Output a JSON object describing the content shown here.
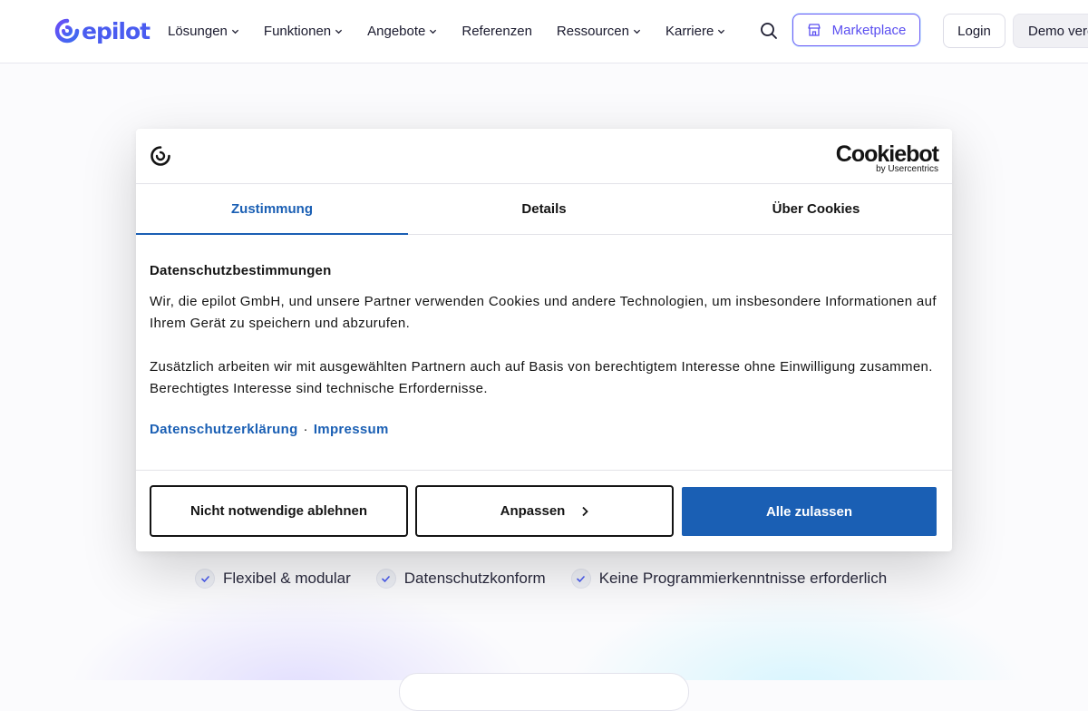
{
  "header": {
    "logo_text": "epilot",
    "nav": [
      {
        "label": "Lösungen",
        "has_dropdown": true
      },
      {
        "label": "Funktionen",
        "has_dropdown": true
      },
      {
        "label": "Angebote",
        "has_dropdown": true
      },
      {
        "label": "Referenzen",
        "has_dropdown": false
      },
      {
        "label": "Ressourcen",
        "has_dropdown": true
      },
      {
        "label": "Karriere",
        "has_dropdown": true
      }
    ],
    "search_icon": "search-icon",
    "marketplace_label": "Marketplace",
    "login_label": "Login",
    "demo_label": "Demo vereinbaren"
  },
  "page": {
    "features": [
      "Flexibel & modular",
      "Datenschutzkonform",
      "Keine Programmierkenntnisse erforderlich"
    ]
  },
  "cookie_dialog": {
    "brand_name": "Cookiebot",
    "brand_by": "by Usercentrics",
    "tabs": [
      "Zustimmung",
      "Details",
      "Über Cookies"
    ],
    "active_tab": "Zustimmung",
    "title": "Datenschutzbestimmungen",
    "paragraph1": "Wir, die epilot GmbH, und unsere Partner verwenden Cookies und andere Technologien, um insbesondere Informationen auf Ihrem Gerät zu speichern und abzurufen.",
    "paragraph2": "Zusätzlich arbeiten wir mit ausgewählten Partnern auch auf Basis von berechtigtem Interesse ohne Einwilligung zusam­men. Berechtigtes Interesse sind technische Erfordernisse.",
    "link_privacy": "Datenschutzerklärung",
    "link_separator": "·",
    "link_imprint": "Impressum",
    "btn_reject": "Nicht notwendige ablehnen",
    "btn_customize": "Anpassen",
    "btn_allow": "Alle zulassen"
  },
  "colors": {
    "brand": "#4a5cf0",
    "cookiebot_blue": "#1a5fb4",
    "text": "#141414"
  }
}
